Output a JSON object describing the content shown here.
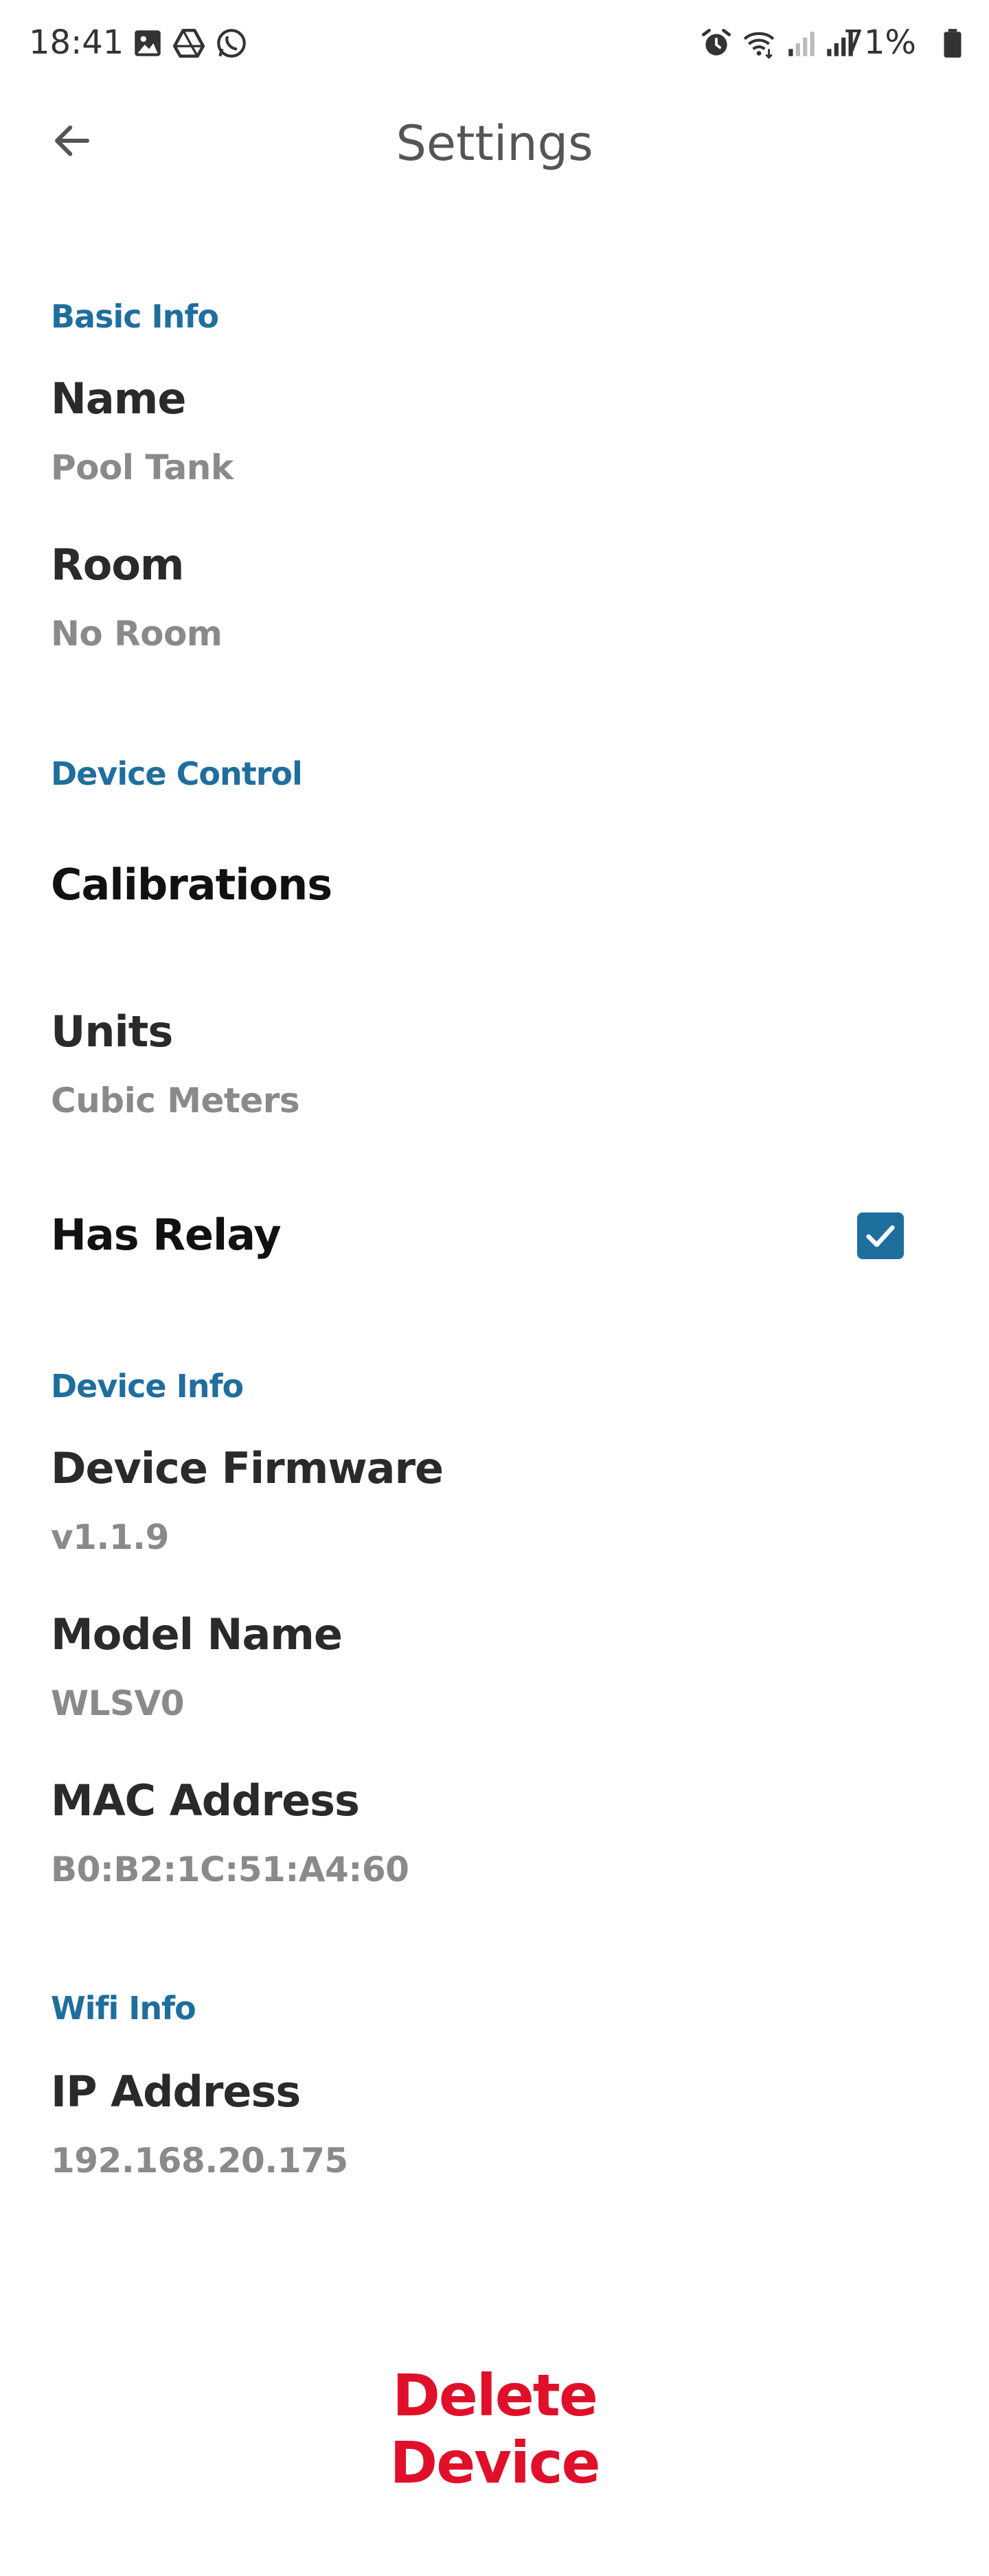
{
  "status_bar": {
    "time": "18:41",
    "battery": "71%",
    "left_icons": [
      "gallery-icon",
      "drive-icon",
      "whatsapp-icon"
    ],
    "right_icons": [
      "alarm-icon",
      "wifi-icon",
      "signal-weak-icon",
      "signal-icon",
      "battery-icon"
    ]
  },
  "app_bar": {
    "title": "Settings",
    "back_icon": "arrow-left-icon"
  },
  "sections": {
    "basic_info": {
      "header": "Basic Info",
      "name_label": "Name",
      "name_value": "Pool Tank",
      "room_label": "Room",
      "room_value": "No Room"
    },
    "device_control": {
      "header": "Device Control",
      "calibrations_label": "Calibrations",
      "units_label": "Units",
      "units_value": "Cubic Meters",
      "has_relay_label": "Has Relay",
      "has_relay_checked": true
    },
    "device_info": {
      "header": "Device Info",
      "firmware_label": "Device Firmware",
      "firmware_value": "v1.1.9",
      "model_label": "Model Name",
      "model_value": "WLSV0",
      "mac_label": "MAC Address",
      "mac_value": "B0:B2:1C:51:A4:60"
    },
    "wifi_info": {
      "header": "Wifi Info",
      "ip_label": "IP Address",
      "ip_value": "192.168.20.175"
    }
  },
  "actions": {
    "delete_label": "Delete Device"
  },
  "colors": {
    "accent": "#1e6e9e",
    "danger": "#e0102a",
    "value_text": "#8a8a8a",
    "label_text": "#2a2a2a"
  }
}
